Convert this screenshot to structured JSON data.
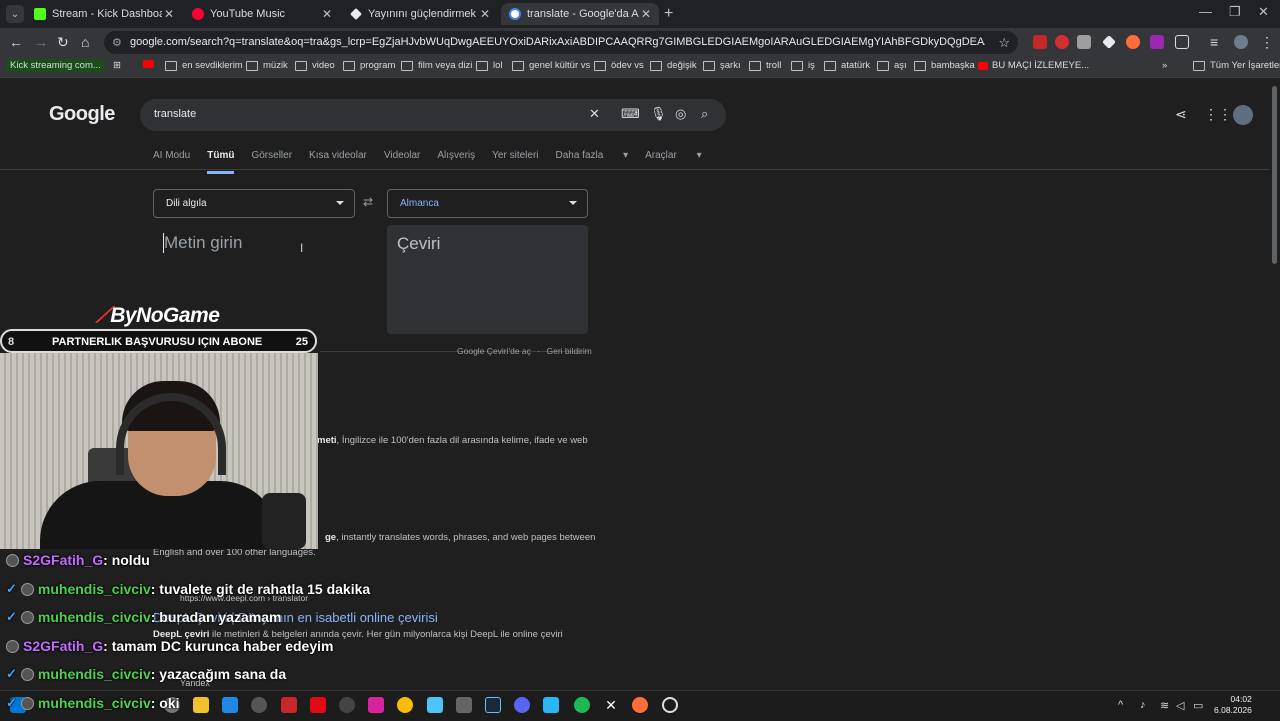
{
  "tabs": [
    {
      "title": "Stream - Kick Dashboard",
      "color": "#53fc18"
    },
    {
      "title": "YouTube Music",
      "color": "#ff0033"
    },
    {
      "title": "Yayınını güçlendirmek için en iy",
      "color": "#e8eaed"
    },
    {
      "title": "translate - Google'da Ara",
      "color": "#4285f4"
    }
  ],
  "url": "google.com/search?q=translate&oq=tra&gs_lcrp=EgZjaHJvbWUqDwgAEEUYOxiDARixAxiABDIPCAAQRRg7GIMBGLEDGIAEMgoIARAuGLEDGIAEMgYIAhBFGDkyDQgDEAAYgwEYsQMYgAQyCggEEAAYsQMYgA...",
  "bookmarks": [
    "Kick streaming com...",
    "en sevdiklerim",
    "müzik",
    "video",
    "program",
    "film veya dizi",
    "lol",
    "genel kültür vs",
    "ödev vs",
    "değişik",
    "şarkı",
    "troll",
    "iş",
    "atatürk",
    "aşı",
    "bambaşka",
    "BU MAÇI İZLEMEYE...",
    "Tüm Yer İşaretleri"
  ],
  "google": {
    "logo": "Google",
    "query": "translate",
    "nav": [
      "AI Modu",
      "Tümü",
      "Görseller",
      "Kısa videolar",
      "Videolar",
      "Alışveriş",
      "Yer siteleri",
      "Daha fazla",
      "Araçlar"
    ],
    "source_lang": "Dili algıla",
    "target_lang": "Almanca",
    "source_placeholder": "Metin girin",
    "target_placeholder": "Çeviri",
    "footer_open": "Google Çeviri'de aç",
    "footer_sep": "·",
    "footer_feedback": "Geri bildirim",
    "result1_snippet_bold": "meti",
    "result1_snippet": ", İngilizce ile 100'den fazla dil arasında kelime, ifade ve web",
    "result2_snippet_bold": "ge",
    "result2_snippet": ", instantly translates words, phrases, and web pages between",
    "result2_snippet2": "English and over 100 other languages.",
    "result3_url": "https://www.deepl.com › translator",
    "result3_title_a": "DeepL Çeviri | Dünyanın",
    "result3_title_b": "en isabetli online çevirisi",
    "result3_snippet_bold": "DeepL çeviri",
    "result3_snippet": " ile metinleri & belgeleri anında çevir. Her gün milyonlarca kişi DeepL ile online çeviri",
    "result4_source": "Yandex"
  },
  "overlay": {
    "brand": "ByNoGame",
    "partner_left": "8",
    "partner_text": "PARTNERLIK BAŞVURUSU IÇIN ABONE",
    "partner_right": "25"
  },
  "chat": [
    {
      "user": "S2GFatih_G",
      "msg": "noldu",
      "verified": false
    },
    {
      "user": "muhendis_civciv",
      "msg": "tuvalete git de rahatla 15 dakika",
      "verified": true
    },
    {
      "user": "muhendis_civciv",
      "msg": "buradan yazamam",
      "verified": true
    },
    {
      "user": "S2GFatih_G",
      "msg": "tamam DC kurunca haber edeyim",
      "verified": false
    },
    {
      "user": "muhendis_civciv",
      "msg": "yazacağım sana da",
      "verified": true
    },
    {
      "user": "muhendis_civciv",
      "msg": "oki",
      "verified": true
    }
  ],
  "clock": {
    "time": "04:02",
    "date": "6.08.2026"
  }
}
